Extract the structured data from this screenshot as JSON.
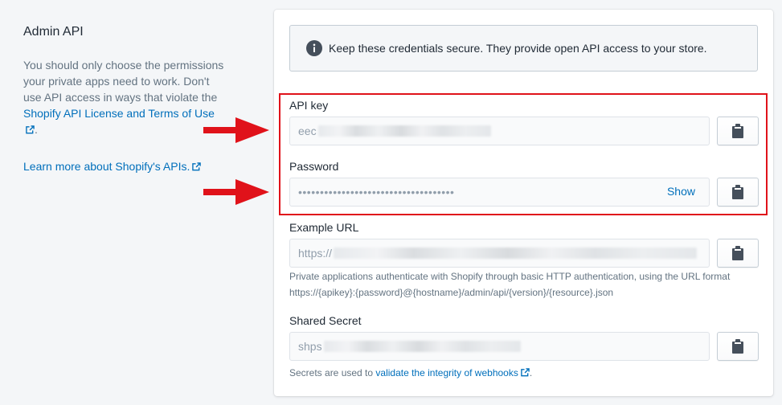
{
  "section": {
    "title": "Admin API",
    "desc_part1": "You should only choose the permissions your private apps need to work. Don't use API access in ways that violate the",
    "license_link": "Shopify API License and Terms of Use",
    "desc_end": ".",
    "learn_link": "Learn more about Shopify's APIs."
  },
  "banner": {
    "icon": "info-icon",
    "text": "Keep these credentials secure. They provide open API access to your store."
  },
  "fields": {
    "api_key": {
      "label": "API key",
      "value_prefix": "eec"
    },
    "password": {
      "label": "Password",
      "value": "••••••••••••••••••••••••••••••••••••",
      "show_label": "Show"
    },
    "example_url": {
      "label": "Example URL",
      "value_prefix": "https://",
      "help_line1": "Private applications authenticate with Shopify through basic HTTP authentication, using the URL format",
      "help_line2": "https://{apikey}:{password}@{hostname}/admin/api/{version}/{resource}.json"
    },
    "shared_secret": {
      "label": "Shared Secret",
      "value_prefix": "shps",
      "help_prefix": "Secrets are used to",
      "help_link": "validate the integrity of webhooks",
      "help_end": "."
    }
  },
  "colors": {
    "link": "#006fbb",
    "highlight": "#e0121a",
    "arrow": "#e0121a"
  }
}
